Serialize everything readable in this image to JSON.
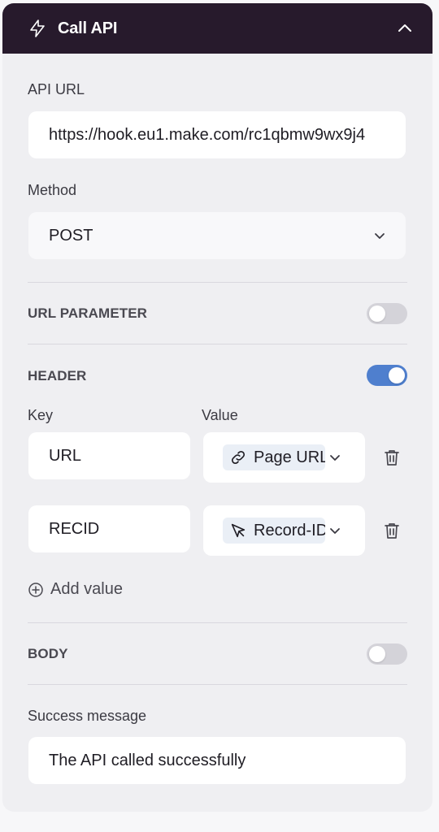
{
  "header": {
    "title": "Call API",
    "icon": "bolt-icon",
    "collapse_icon": "chevron-up-icon"
  },
  "api_url": {
    "label": "API URL",
    "value": "https://hook.eu1.make.com/rc1qbmw9wx9j4"
  },
  "method": {
    "label": "Method",
    "value": "POST"
  },
  "url_parameter": {
    "label": "URL PARAMETER",
    "enabled": false
  },
  "header_section": {
    "label": "HEADER",
    "enabled": true,
    "key_label": "Key",
    "value_label": "Value",
    "rows": [
      {
        "key": "URL",
        "value": "Page URL",
        "value_icon": "link-icon"
      },
      {
        "key": "RECID",
        "value": "Record-ID",
        "value_icon": "cursor-icon"
      }
    ],
    "add_value_label": "Add value"
  },
  "body_section": {
    "label": "BODY",
    "enabled": false
  },
  "success_message": {
    "label": "Success message",
    "value": "The API called successfully"
  },
  "colors": {
    "header_bg": "#271a2c",
    "toggle_on": "#4f7fce",
    "toggle_off": "#d4d3d9"
  }
}
